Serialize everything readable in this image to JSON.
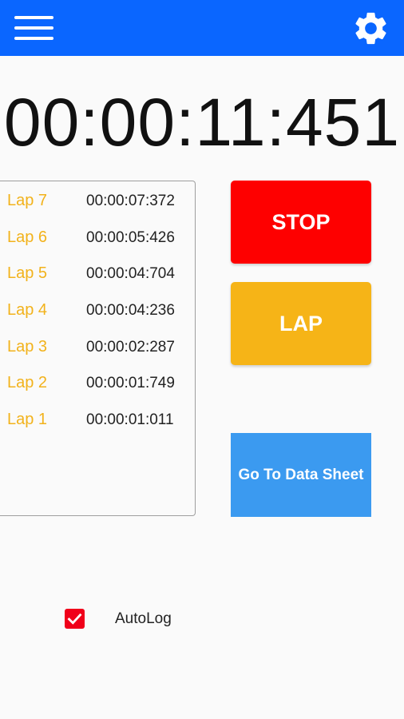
{
  "appbar": {
    "color": "#0a66ff",
    "menu_icon": "menu-icon",
    "settings_icon": "gear-icon"
  },
  "timer": {
    "display": "00:00:11:451"
  },
  "laps": [
    {
      "label": "Lap 7",
      "time": "00:00:07:372"
    },
    {
      "label": "Lap 6",
      "time": "00:00:05:426"
    },
    {
      "label": "Lap 5",
      "time": "00:00:04:704"
    },
    {
      "label": "Lap 4",
      "time": "00:00:04:236"
    },
    {
      "label": "Lap 3",
      "time": "00:00:02:287"
    },
    {
      "label": "Lap 2",
      "time": "00:00:01:749"
    },
    {
      "label": "Lap 1",
      "time": "00:00:01:011"
    }
  ],
  "buttons": {
    "stop_label": "STOP",
    "lap_label": "LAP",
    "data_sheet_label": "Go To Data Sheet",
    "stop_color": "#fe0000",
    "lap_color": "#f6b417",
    "data_sheet_color": "#3b9af0"
  },
  "autolog": {
    "label": "AutoLog",
    "checked": true
  }
}
